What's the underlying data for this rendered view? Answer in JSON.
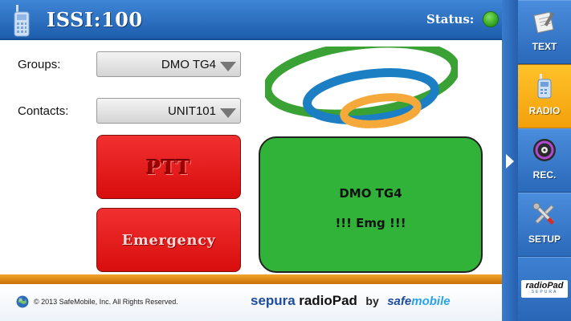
{
  "header": {
    "title": "ISSI:100",
    "status_label": "Status:",
    "status_color": "#2e9d1f",
    "icon": "radio-handset-icon"
  },
  "form": {
    "groups_label": "Groups:",
    "groups_value": "DMO TG4",
    "contacts_label": "Contacts:",
    "contacts_value": "UNIT101"
  },
  "buttons": {
    "ptt_label": "PTT",
    "emergency_label": "Emergency"
  },
  "call_panel": {
    "group": "DMO TG4",
    "message": "!!! Emg !!!",
    "color": "#31b33a"
  },
  "sidebar": {
    "items": [
      {
        "label": "TEXT",
        "icon": "notepad-icon",
        "active": false
      },
      {
        "label": "RADIO",
        "icon": "radio-icon",
        "active": true
      },
      {
        "label": "REC.",
        "icon": "disc-icon",
        "active": false
      },
      {
        "label": "SETUP",
        "icon": "tools-icon",
        "active": false
      }
    ],
    "brand_text": "radioPad",
    "brand_sub": "SEPURA"
  },
  "footer": {
    "copyright": "© 2013 SafeMobile, Inc. All Rights Reserved.",
    "brand_sepura": "sepura",
    "brand_radiopad": "radioPad",
    "brand_by": "by",
    "brand_safe": "safe",
    "brand_mobile": "mobile"
  },
  "colors": {
    "header_blue": "#1d5dac",
    "button_red": "#e01a1a",
    "active_orange": "#f3a00a",
    "footer_orange": "#e08a14"
  }
}
